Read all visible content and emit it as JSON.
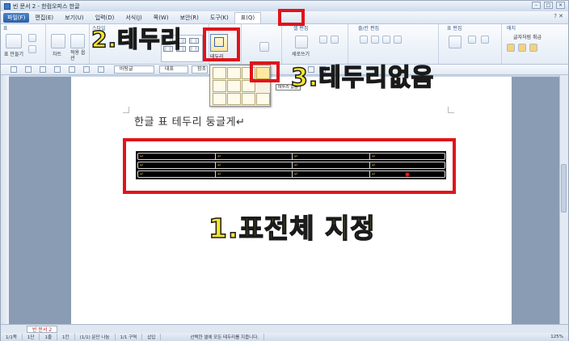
{
  "window": {
    "title": "빈 문서 2 - 한컴오피스 한글"
  },
  "menu": {
    "file": "파일(F)",
    "items": [
      "편집(E)",
      "보기(U)",
      "입력(D)",
      "서식(J)",
      "쪽(W)",
      "보안(R)",
      "도구(K)",
      "표(Q)"
    ],
    "right": "? ✕"
  },
  "ribbon": {
    "groups": [
      "표",
      "스타일",
      "셀 편집",
      "줄/칸 편집",
      "표 편집",
      "매치"
    ],
    "buttons": {
      "table": "표 만들기",
      "chart": "차트",
      "apply": "적용 옵션",
      "border": "테두리",
      "vertical": "세로쓰기",
      "shade": "글자처럼 취급"
    }
  },
  "toolbar": {
    "style_combo": "바탕글",
    "font_combo": "대표",
    "size_combo": "함초"
  },
  "popup": {
    "tooltip": "테두리 없음"
  },
  "document": {
    "heading": "한글 표 테두리 둥글게↵",
    "cell_mark": "↵"
  },
  "annotations": {
    "step1": "1.표전체 지정",
    "step2": "2.테두리",
    "step3": "3.테두리없음"
  },
  "bottom": {
    "doc_tab": "빈 문서 2",
    "status": [
      "1/1쪽",
      "1단",
      "1줄",
      "1칸",
      "(1/1) 문단 나눔",
      "1/1 구역",
      "삽입",
      "선택한 셀에 모든 테두리를 지웁니다.",
      "125%"
    ]
  },
  "colors": {
    "annotation_red": "#e0141b",
    "annotation_yellow": "#f6e62a",
    "table_fill": "#000000"
  }
}
